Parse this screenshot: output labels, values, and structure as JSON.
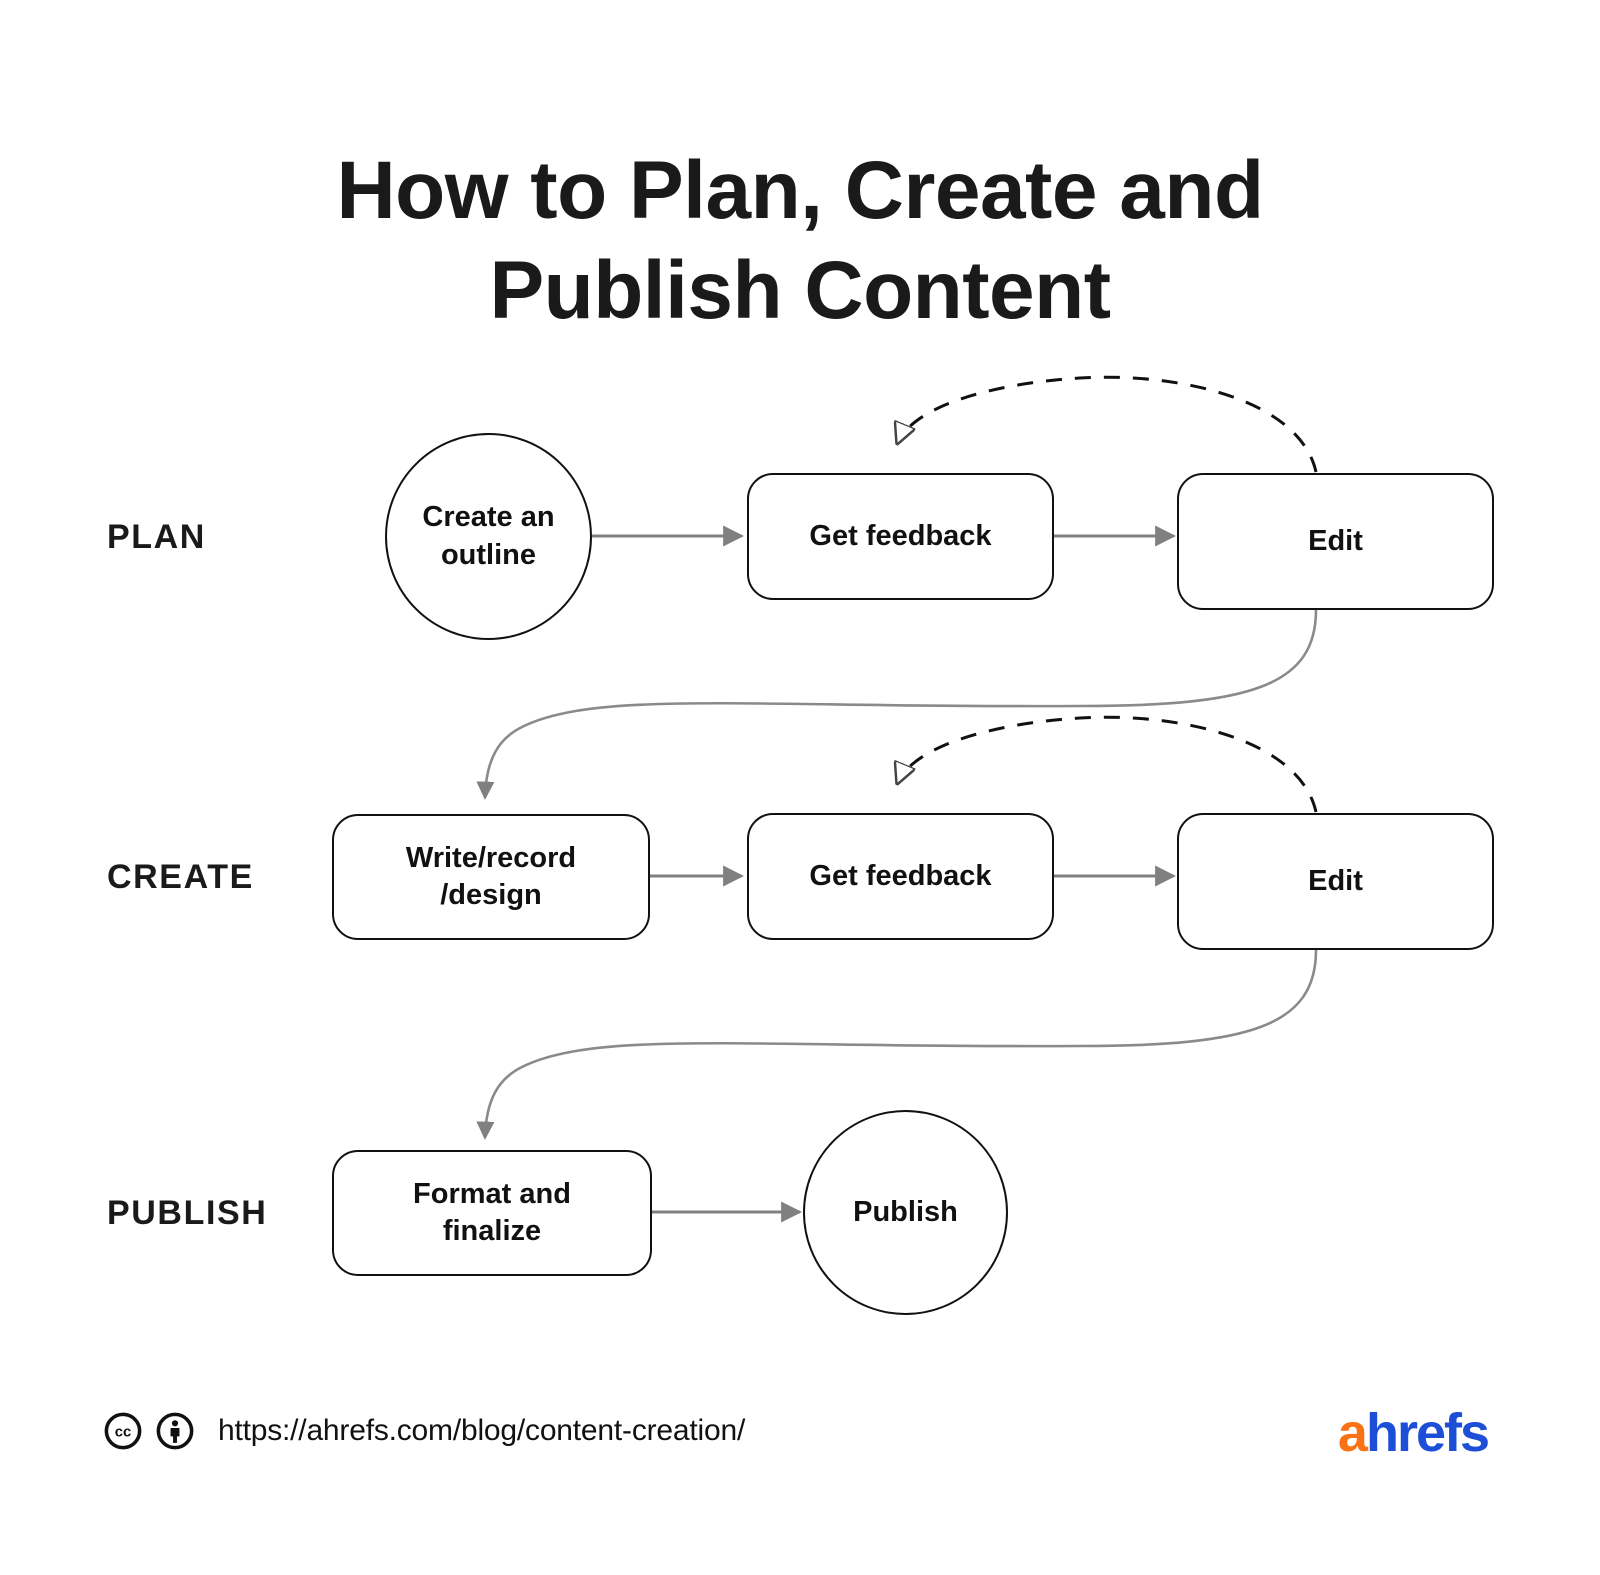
{
  "title": {
    "line1": "How to Plan, Create and",
    "line2": "Publish Content"
  },
  "colors": {
    "ink": "#111111",
    "arrow": "#808080",
    "logo_orange": "#F97316",
    "logo_blue": "#1D4ED8",
    "background": "#FFFFFF"
  },
  "stages": [
    {
      "id": "plan",
      "label": "PLAN"
    },
    {
      "id": "create",
      "label": "CREATE"
    },
    {
      "id": "publish",
      "label": "PUBLISH"
    }
  ],
  "nodes": {
    "create_outline": {
      "label": "Create an outline",
      "shape": "circle"
    },
    "plan_feedback": {
      "label": "Get feedback",
      "shape": "rect"
    },
    "plan_edit": {
      "label": "Edit",
      "shape": "rect"
    },
    "write_record": {
      "label": "Write/record /design",
      "shape": "rect"
    },
    "create_feedback": {
      "label": "Get feedback",
      "shape": "rect"
    },
    "create_edit": {
      "label": "Edit",
      "shape": "rect"
    },
    "format_finalize": {
      "label": "Format and finalize",
      "shape": "rect"
    },
    "publish": {
      "label": "Publish",
      "shape": "circle"
    }
  },
  "node_lines": {
    "create_outline": {
      "l1": "Create an",
      "l2": "outline"
    },
    "write_record": {
      "l1": "Write/record",
      "l2": "/design"
    },
    "format_finalize": {
      "l1": "Format and",
      "l2": "finalize"
    }
  },
  "edges": [
    {
      "from": "create_outline",
      "to": "plan_feedback",
      "style": "solid",
      "arrow": "filled"
    },
    {
      "from": "plan_feedback",
      "to": "plan_edit",
      "style": "solid",
      "arrow": "filled"
    },
    {
      "from": "plan_edit",
      "to": "plan_feedback",
      "style": "dashed",
      "arrow": "hollow"
    },
    {
      "from": "plan_edit",
      "to": "write_record",
      "style": "solid",
      "arrow": "filled"
    },
    {
      "from": "write_record",
      "to": "create_feedback",
      "style": "solid",
      "arrow": "filled"
    },
    {
      "from": "create_feedback",
      "to": "create_edit",
      "style": "solid",
      "arrow": "filled"
    },
    {
      "from": "create_edit",
      "to": "create_feedback",
      "style": "dashed",
      "arrow": "hollow"
    },
    {
      "from": "create_edit",
      "to": "format_finalize",
      "style": "solid",
      "arrow": "filled"
    },
    {
      "from": "format_finalize",
      "to": "publish",
      "style": "solid",
      "arrow": "filled"
    }
  ],
  "footer": {
    "url": "https://ahrefs.com/blog/content-creation/",
    "license_icons": [
      "cc-icon",
      "by-person-icon"
    ],
    "logo_a": "a",
    "logo_hrefs": "hrefs"
  }
}
